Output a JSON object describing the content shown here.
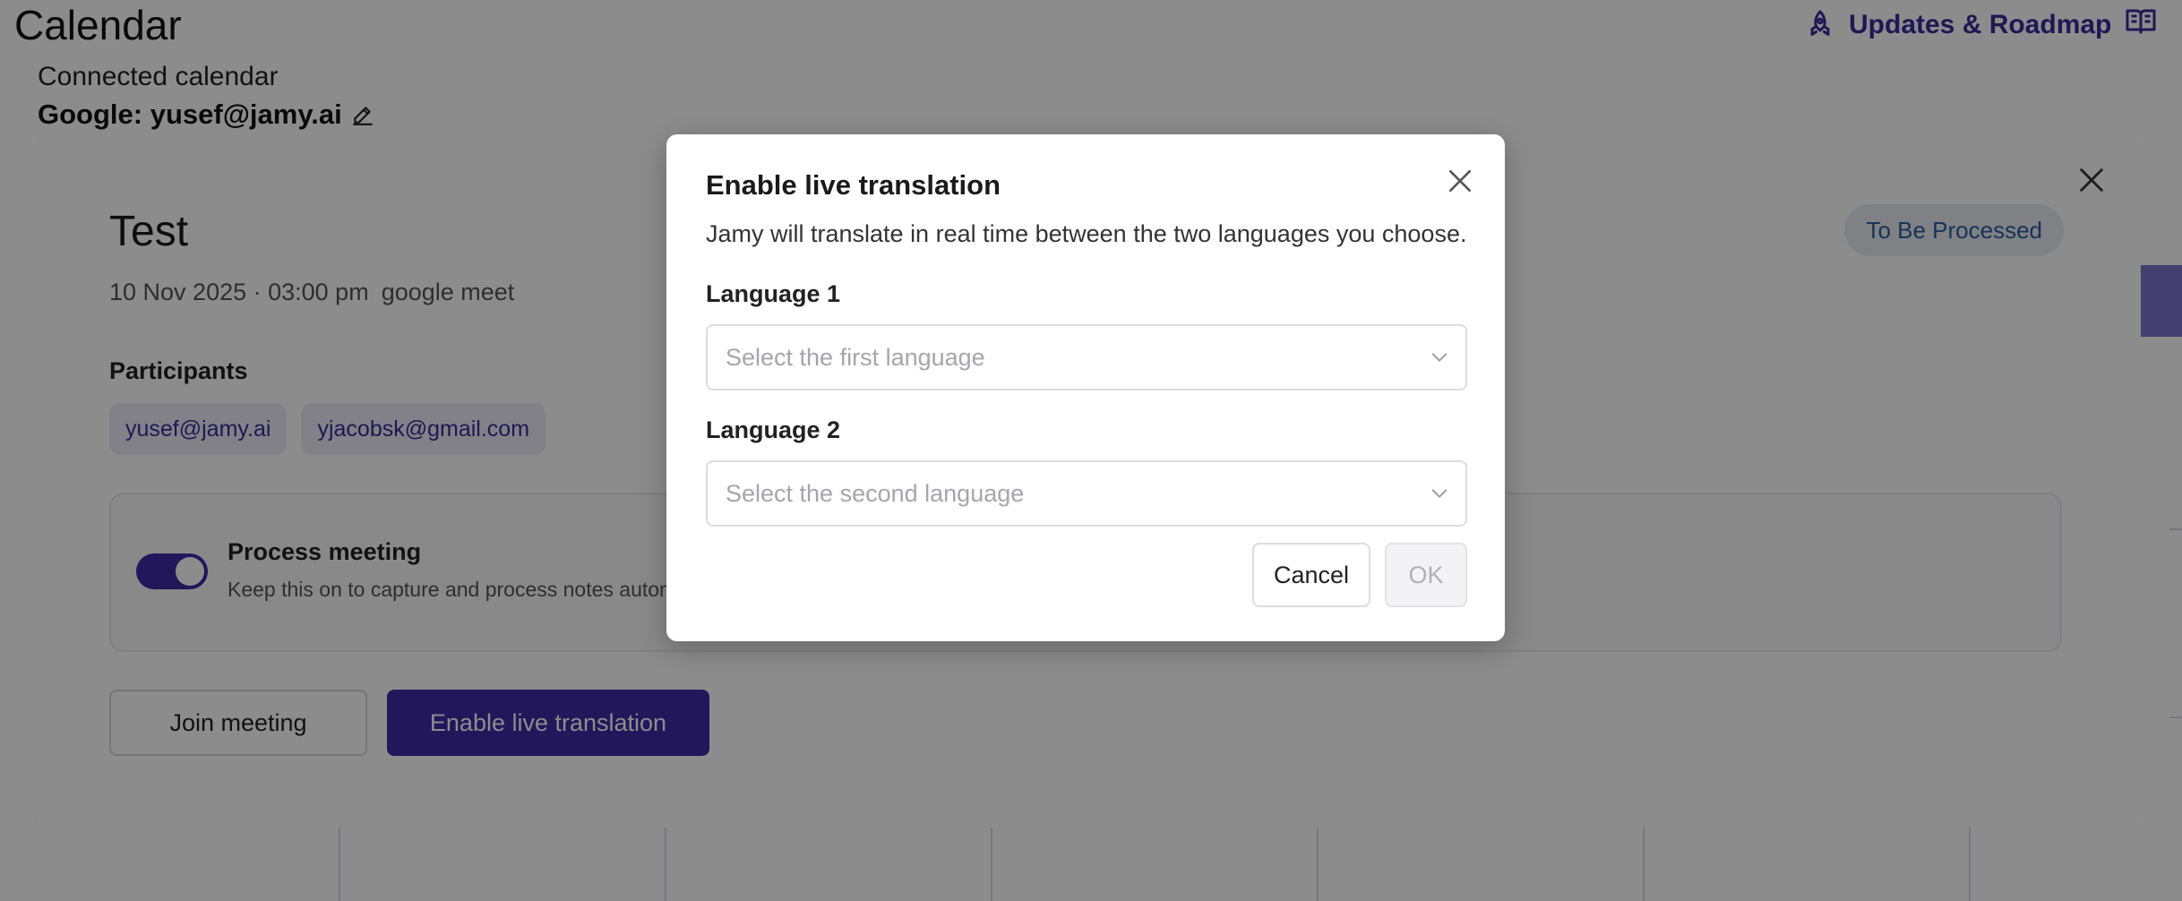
{
  "page": {
    "title": "Calendar",
    "header_links": [
      {
        "label": "Updates & Roadmap",
        "icon": "rocket-icon"
      },
      {
        "label": "",
        "icon": "book-icon"
      }
    ],
    "connected_label": "Connected calendar",
    "connected_value": "Google: yusef@jamy.ai",
    "edit_icon": "pencil-icon"
  },
  "event": {
    "title": "Test",
    "date": "10 Nov 2025 · 03:00 pm",
    "location": "google meet",
    "status": "To Be Processed",
    "participants_label": "Participants",
    "participants": [
      "yusef@jamy.ai",
      "yjacobsk@gmail.com"
    ],
    "process_title": "Process meeting",
    "process_desc": "Keep this on to capture and process notes automatically",
    "process_enabled": true,
    "join_label": "Join meeting",
    "translate_label": "Enable live translation"
  },
  "dialog": {
    "title": "Enable live translation",
    "description": "Jamy will translate in real time between the two languages you choose.",
    "language1_label": "Language 1",
    "language1_placeholder": "Select the first language",
    "language2_label": "Language 2",
    "language2_placeholder": "Select the second language",
    "cancel_label": "Cancel",
    "ok_label": "OK"
  },
  "colors": {
    "accent": "#3f2aa6",
    "status_bg": "#e7ecf3",
    "status_text": "#2a5fa0"
  }
}
